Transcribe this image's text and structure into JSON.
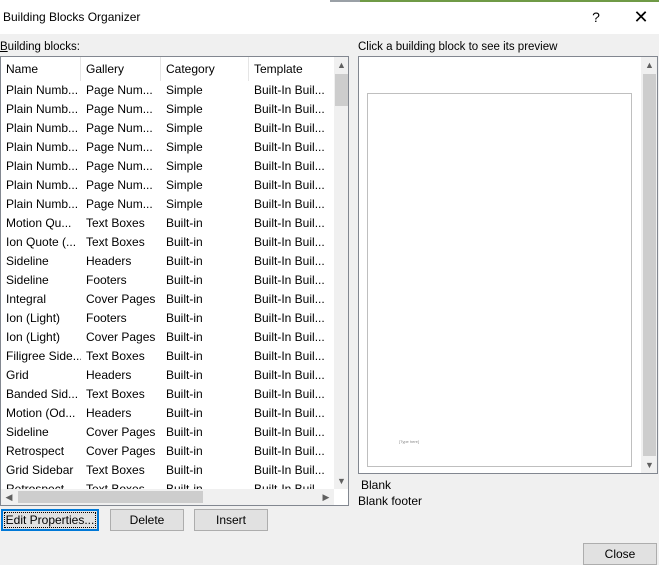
{
  "window": {
    "title": "Building Blocks Organizer",
    "help_label": "?",
    "close_glyph": "✕"
  },
  "labels": {
    "building_blocks": "Building blocks:",
    "preview_hint": "Click a building block to see its preview"
  },
  "columns": [
    "Name",
    "Gallery",
    "Category",
    "Template"
  ],
  "rows": [
    [
      "Plain Numb...",
      "Page Num...",
      "Simple",
      "Built-In Buil..."
    ],
    [
      "Plain Numb...",
      "Page Num...",
      "Simple",
      "Built-In Buil..."
    ],
    [
      "Plain Numb...",
      "Page Num...",
      "Simple",
      "Built-In Buil..."
    ],
    [
      "Plain Numb...",
      "Page Num...",
      "Simple",
      "Built-In Buil..."
    ],
    [
      "Plain Numb...",
      "Page Num...",
      "Simple",
      "Built-In Buil..."
    ],
    [
      "Plain Numb...",
      "Page Num...",
      "Simple",
      "Built-In Buil..."
    ],
    [
      "Plain Numb...",
      "Page Num...",
      "Simple",
      "Built-In Buil..."
    ],
    [
      "Motion Qu...",
      "Text Boxes",
      "Built-in",
      "Built-In Buil..."
    ],
    [
      "Ion Quote (...",
      "Text Boxes",
      "Built-in",
      "Built-In Buil..."
    ],
    [
      "Sideline",
      "Headers",
      "Built-in",
      "Built-In Buil..."
    ],
    [
      "Sideline",
      "Footers",
      "Built-in",
      "Built-In Buil..."
    ],
    [
      "Integral",
      "Cover Pages",
      "Built-in",
      "Built-In Buil..."
    ],
    [
      "Ion (Light)",
      "Footers",
      "Built-in",
      "Built-In Buil..."
    ],
    [
      "Ion (Light)",
      "Cover Pages",
      "Built-in",
      "Built-In Buil..."
    ],
    [
      "Filigree Side...",
      "Text Boxes",
      "Built-in",
      "Built-In Buil..."
    ],
    [
      "Grid",
      "Headers",
      "Built-in",
      "Built-In Buil..."
    ],
    [
      "Banded Sid...",
      "Text Boxes",
      "Built-in",
      "Built-In Buil..."
    ],
    [
      "Motion (Od...",
      "Headers",
      "Built-in",
      "Built-In Buil..."
    ],
    [
      "Sideline",
      "Cover Pages",
      "Built-in",
      "Built-In Buil..."
    ],
    [
      "Retrospect",
      "Cover Pages",
      "Built-in",
      "Built-In Buil..."
    ],
    [
      "Grid Sidebar",
      "Text Boxes",
      "Built-in",
      "Built-In Buil..."
    ],
    [
      "Retrospect",
      "Text Boxes",
      "Built-in",
      "Built-In Buil..."
    ]
  ],
  "preview": {
    "footer_placeholder": "[Type here]",
    "name": "Blank",
    "description": "Blank footer"
  },
  "buttons": {
    "edit_properties": "Edit Properties...",
    "delete": "Delete",
    "insert": "Insert",
    "close": "Close"
  },
  "icons": {
    "scroll_up": "chevron-up-icon",
    "scroll_down": "chevron-down-icon",
    "scroll_left": "chevron-left-icon",
    "scroll_right": "chevron-right-icon"
  },
  "colors": {
    "focus_accent": "#0078d7",
    "title_accent": "#6f9a46"
  }
}
